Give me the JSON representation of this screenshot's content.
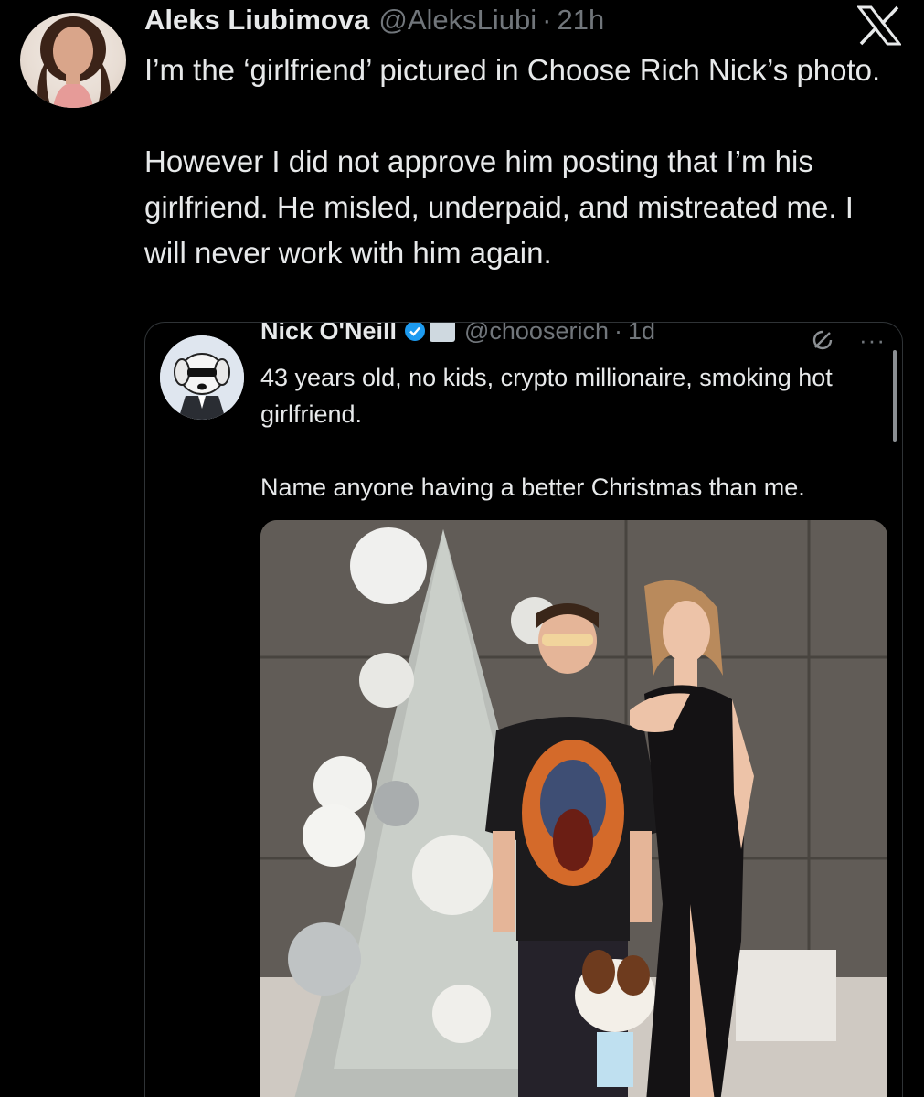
{
  "tweet": {
    "display_name": "Aleks Liubimova",
    "handle": "@AleksLiubi",
    "separator": "·",
    "time": "21h",
    "text": [
      "I’m the ‘girlfriend’ pictured in Choose Rich Nick’s photo.",
      "However I did not approve him posting that I’m his girlfriend. He misled, underpaid, and mistreated me. I will never work with him again."
    ],
    "avatar_icon": "profile-photo",
    "brand_icon": "x-logo-icon"
  },
  "quoted_tweet": {
    "display_name": "Nick O'Neill",
    "handle": "@chooserich",
    "separator": "·",
    "time": "1d",
    "more_label": "···",
    "text": [
      "43 years old, no kids, crypto millionaire, smoking hot girlfriend.",
      "Name anyone having a better Christmas than me."
    ],
    "avatar_icon": "cartoon-dog-avatar",
    "verified_icon": "verified-badge-icon",
    "affiliate_icon": "affiliate-badge-icon",
    "grok_icon": "grok-icon",
    "photo": "christmas-tree-couple-photo"
  },
  "colors": {
    "background": "#000000",
    "primary_text": "#e7e9ea",
    "secondary_text": "#71767b",
    "border": "#2f3336",
    "verified_blue": "#1d9bf0"
  }
}
